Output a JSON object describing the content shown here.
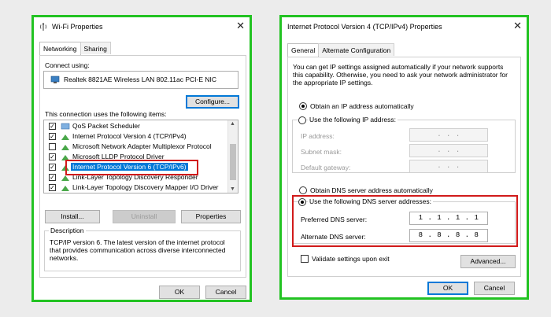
{
  "colors": {
    "highlight_border": "#22c322",
    "callout": "#d11a1a",
    "selection": "#0078d7"
  },
  "left": {
    "title": "Wi-Fi Properties",
    "title_icon": "wifi-icon",
    "close_glyph": "✕",
    "tabs": [
      {
        "label": "Networking",
        "active": true
      },
      {
        "label": "Sharing",
        "active": false
      }
    ],
    "connect_using_label": "Connect using:",
    "adapter_icon": "network-adapter-icon",
    "adapter_name": "Realtek 8821AE Wireless LAN 802.11ac PCI-E NIC",
    "configure_label": "Configure...",
    "items_label": "This connection uses the following items:",
    "items": [
      {
        "label": "QoS Packet Scheduler",
        "checked": true,
        "selected": false
      },
      {
        "label": "Internet Protocol Version 4 (TCP/IPv4)",
        "checked": true,
        "selected": false
      },
      {
        "label": "Microsoft Network Adapter Multiplexor Protocol",
        "checked": false,
        "selected": false
      },
      {
        "label": "Microsoft LLDP Protocol Driver",
        "checked": true,
        "selected": false
      },
      {
        "label": "Internet Protocol Version 6 (TCP/IPv6)",
        "checked": true,
        "selected": true
      },
      {
        "label": "Link-Layer Topology Discovery Responder",
        "checked": true,
        "selected": false
      },
      {
        "label": "Link-Layer Topology Discovery Mapper I/O Driver",
        "checked": true,
        "selected": false
      }
    ],
    "check_glyph": "✓",
    "install_label": "Install...",
    "uninstall_label": "Uninstall",
    "properties_label": "Properties",
    "description_legend": "Description",
    "description_text": "TCP/IP version 6. The latest version of the internet protocol that provides communication across diverse interconnected networks.",
    "ok_label": "OK",
    "cancel_label": "Cancel"
  },
  "right": {
    "title": "Internet Protocol Version 4 (TCP/IPv4) Properties",
    "close_glyph": "✕",
    "tabs": [
      {
        "label": "General",
        "active": true
      },
      {
        "label": "Alternate Configuration",
        "active": false
      }
    ],
    "intro_text": "You can get IP settings assigned automatically if your network supports this capability. Otherwise, you need to ask your network administrator for the appropriate IP settings.",
    "obtain_ip_auto": "Obtain an IP address automatically",
    "use_following_ip": "Use the following IP address:",
    "ip_address_label": "IP address:",
    "subnet_mask_label": "Subnet mask:",
    "default_gateway_label": "Default gateway:",
    "empty_ip": ".   .   .",
    "obtain_dns_auto": "Obtain DNS server address automatically",
    "use_following_dns": "Use the following DNS server addresses:",
    "preferred_dns_label": "Preferred DNS server:",
    "preferred_dns_value": "1 . 1 . 1 . 1",
    "alternate_dns_label": "Alternate DNS server:",
    "alternate_dns_value": "8 . 8 . 8 . 8",
    "validate_label": "Validate settings upon exit",
    "validate_checked": false,
    "advanced_label": "Advanced...",
    "ok_label": "OK",
    "cancel_label": "Cancel"
  }
}
